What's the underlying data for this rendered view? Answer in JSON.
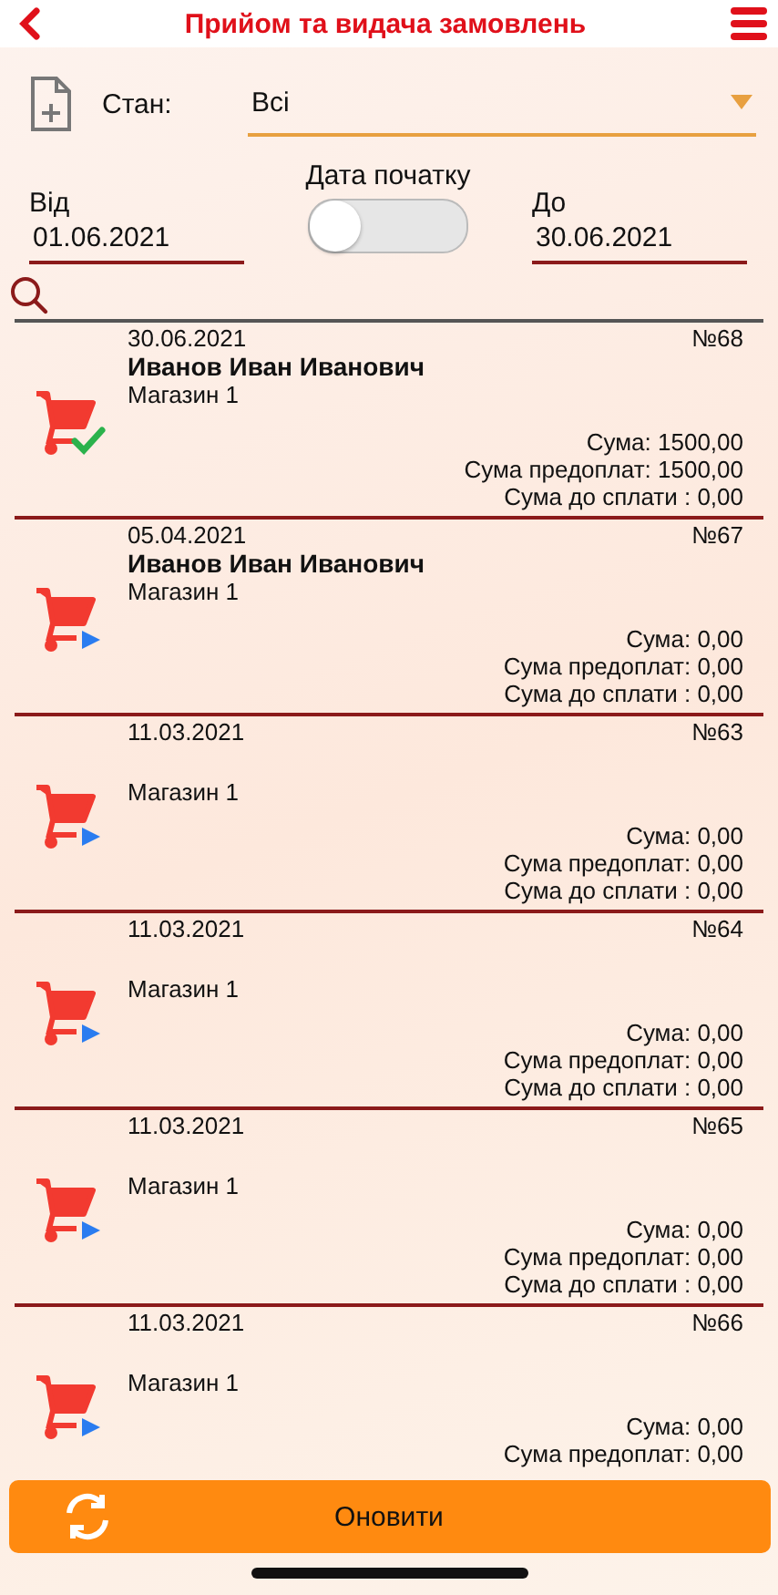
{
  "header": {
    "title": "Прийом та видача замовлень"
  },
  "filters": {
    "state_label": "Стан:",
    "state_value": "Всі",
    "start_date_label": "Дата початку",
    "start_date_on": false,
    "from_label": "Від",
    "from_value": "01.06.2021",
    "to_label": "До",
    "to_value": "30.06.2021"
  },
  "orders": [
    {
      "date": "30.06.2021",
      "number": "№68",
      "customer": "Иванов Иван Иванович",
      "shop": "Магазин 1",
      "kind": "done",
      "sum": "Сума: 1500,00",
      "prepaid": "Сума предоплат: 1500,00",
      "due": "Сума до сплати : 0,00"
    },
    {
      "date": "05.04.2021",
      "number": "№67",
      "customer": "Иванов Иван Иванович",
      "shop": "Магазин 1",
      "kind": "pending",
      "sum": "Сума: 0,00",
      "prepaid": "Сума предоплат: 0,00",
      "due": "Сума до сплати : 0,00"
    },
    {
      "date": "11.03.2021",
      "number": "№63",
      "shop": "Магазин 1",
      "kind": "pending",
      "sum": "Сума: 0,00",
      "prepaid": "Сума предоплат: 0,00",
      "due": "Сума до сплати : 0,00"
    },
    {
      "date": "11.03.2021",
      "number": "№64",
      "shop": "Магазин 1",
      "kind": "pending",
      "sum": "Сума: 0,00",
      "prepaid": "Сума предоплат: 0,00",
      "due": "Сума до сплати : 0,00"
    },
    {
      "date": "11.03.2021",
      "number": "№65",
      "shop": "Магазин 1",
      "kind": "pending",
      "sum": "Сума: 0,00",
      "prepaid": "Сума предоплат: 0,00",
      "due": "Сума до сплати : 0,00"
    },
    {
      "date": "11.03.2021",
      "number": "№66",
      "shop": "Магазин 1",
      "kind": "pending",
      "sum": "Сума: 0,00",
      "prepaid": "Сума предоплат: 0,00"
    }
  ],
  "refresh_button": {
    "label": "Оновити"
  }
}
